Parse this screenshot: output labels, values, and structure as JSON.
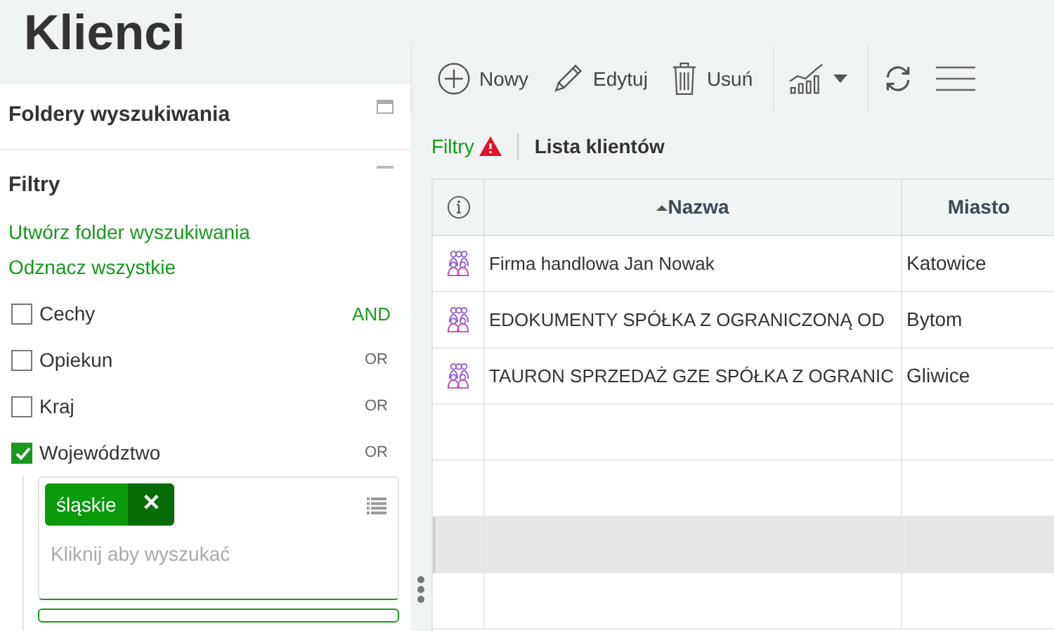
{
  "page": {
    "title": "Klienci"
  },
  "sidebar": {
    "folders_title": "Foldery wyszukiwania",
    "filters_title": "Filtry",
    "links": [
      "Utwórz folder wyszukiwania",
      "Odznacz wszystkie"
    ],
    "filters": [
      {
        "label": "Cechy",
        "checked": false,
        "operator": "AND",
        "operator_highlighted": true
      },
      {
        "label": "Opiekun",
        "checked": false,
        "operator": "OR",
        "operator_highlighted": false
      },
      {
        "label": "Kraj",
        "checked": false,
        "operator": "OR",
        "operator_highlighted": false
      },
      {
        "label": "Województwo",
        "checked": true,
        "operator": "OR",
        "operator_highlighted": false,
        "tokens": [
          "śląskie"
        ],
        "remove_symbol": "✕",
        "placeholder": "Kliknij aby wyszukać"
      }
    ]
  },
  "toolbar": {
    "buttons": [
      {
        "kind": "new",
        "label": "Nowy"
      },
      {
        "kind": "edit",
        "label": "Edytuj"
      },
      {
        "kind": "delete",
        "label": "Usuń"
      },
      {
        "kind": "chart"
      },
      {
        "kind": "refresh"
      },
      {
        "kind": "menu"
      }
    ]
  },
  "tabs": [
    {
      "label": "Filtry",
      "kind": "filters",
      "warning": true
    },
    {
      "label": "Lista klientów",
      "kind": "list",
      "warning": false
    }
  ],
  "table": {
    "columns": [
      {
        "kind": "info"
      },
      {
        "kind": "text",
        "label": "Nazwa",
        "sorted": true
      },
      {
        "kind": "text",
        "label": "Miasto",
        "sorted": false
      }
    ],
    "rows": [
      {
        "name": "Firma handlowa Jan Nowak",
        "city": "Katowice",
        "selected": false
      },
      {
        "name": "EDOKUMENTY SPÓŁKA Z OGRANICZONĄ OD",
        "city": "Bytom",
        "selected": false
      },
      {
        "name": "TAURON SPRZEDAŻ GZE SPÓŁKA Z OGRANIC",
        "city": "Gliwice",
        "selected": false
      },
      {
        "selected": false
      },
      {
        "selected": false
      },
      {
        "selected": true
      },
      {
        "selected": false
      }
    ]
  }
}
